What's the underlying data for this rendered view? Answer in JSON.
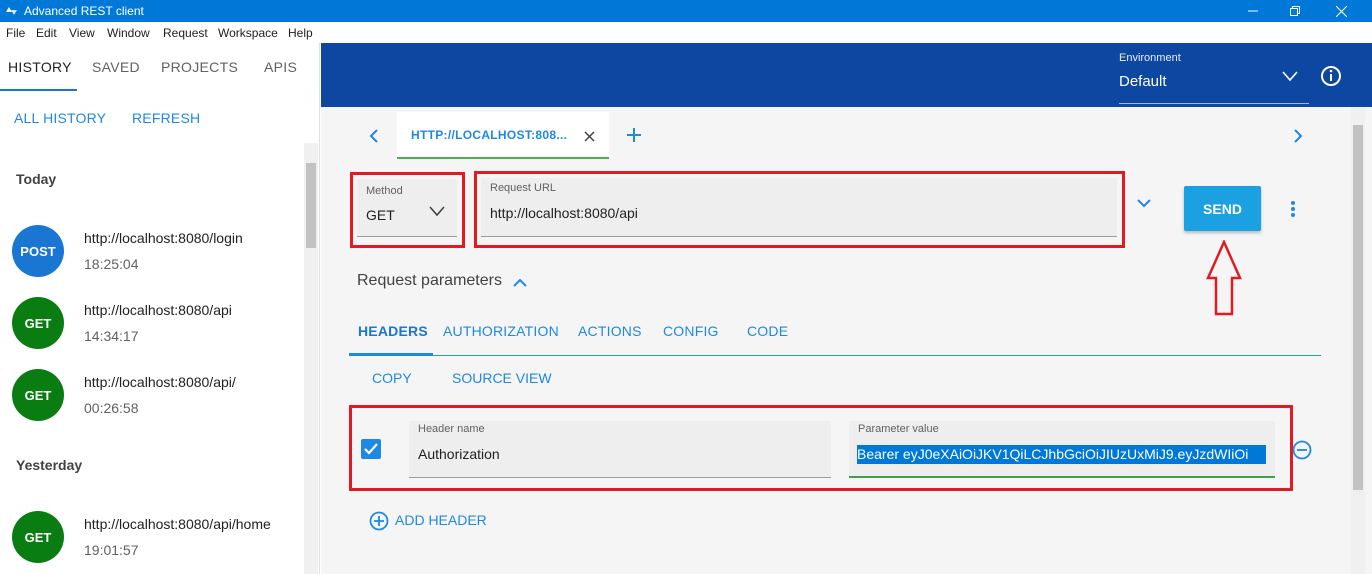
{
  "window": {
    "title": "Advanced REST client"
  },
  "menu": [
    "File",
    "Edit",
    "View",
    "Window",
    "Request",
    "Workspace",
    "Help"
  ],
  "sidebar": {
    "tabs": [
      "HISTORY",
      "SAVED",
      "PROJECTS",
      "APIS"
    ],
    "actions": {
      "all_history": "ALL HISTORY",
      "refresh": "REFRESH"
    },
    "groups": {
      "today": "Today",
      "yesterday": "Yesterday"
    },
    "items": [
      {
        "method": "POST",
        "url": "http://localhost:8080/login",
        "time": "18:25:04",
        "color": "#1976d2"
      },
      {
        "method": "GET",
        "url": "http://localhost:8080/api",
        "time": "14:34:17",
        "color": "#0a7d12"
      },
      {
        "method": "GET",
        "url": "http://localhost:8080/api/",
        "time": "00:26:58",
        "color": "#0a7d12"
      },
      {
        "method": "GET",
        "url": "http://localhost:8080/api/home",
        "time": "19:01:57",
        "color": "#0a7d12"
      }
    ]
  },
  "header": {
    "environment_label": "Environment",
    "environment_value": "Default"
  },
  "request_tab": {
    "label": "HTTP://LOCALHOST:808..."
  },
  "request": {
    "method_label": "Method",
    "method_value": "GET",
    "url_label": "Request URL",
    "url_value": "http://localhost:8080/api",
    "send_label": "SEND"
  },
  "params": {
    "section_label": "Request parameters",
    "tabs": [
      "HEADERS",
      "AUTHORIZATION",
      "ACTIONS",
      "CONFIG",
      "CODE"
    ],
    "copy_label": "COPY",
    "source_view_label": "SOURCE VIEW",
    "header_row": {
      "name_label": "Header name",
      "name_value": "Authorization",
      "value_label": "Parameter value",
      "value_value": "Bearer eyJ0eXAiOiJKV1QiLCJhbGciOiJIUzUxMiJ9.eyJzdWIiOi",
      "checked": true
    },
    "add_header_label": "ADD HEADER"
  },
  "colors": {
    "titlebar": "#0078d7",
    "header": "#0d47a1",
    "accent": "#1e88e5",
    "send": "#1ba1e2",
    "highlight_box": "#e11b22"
  }
}
